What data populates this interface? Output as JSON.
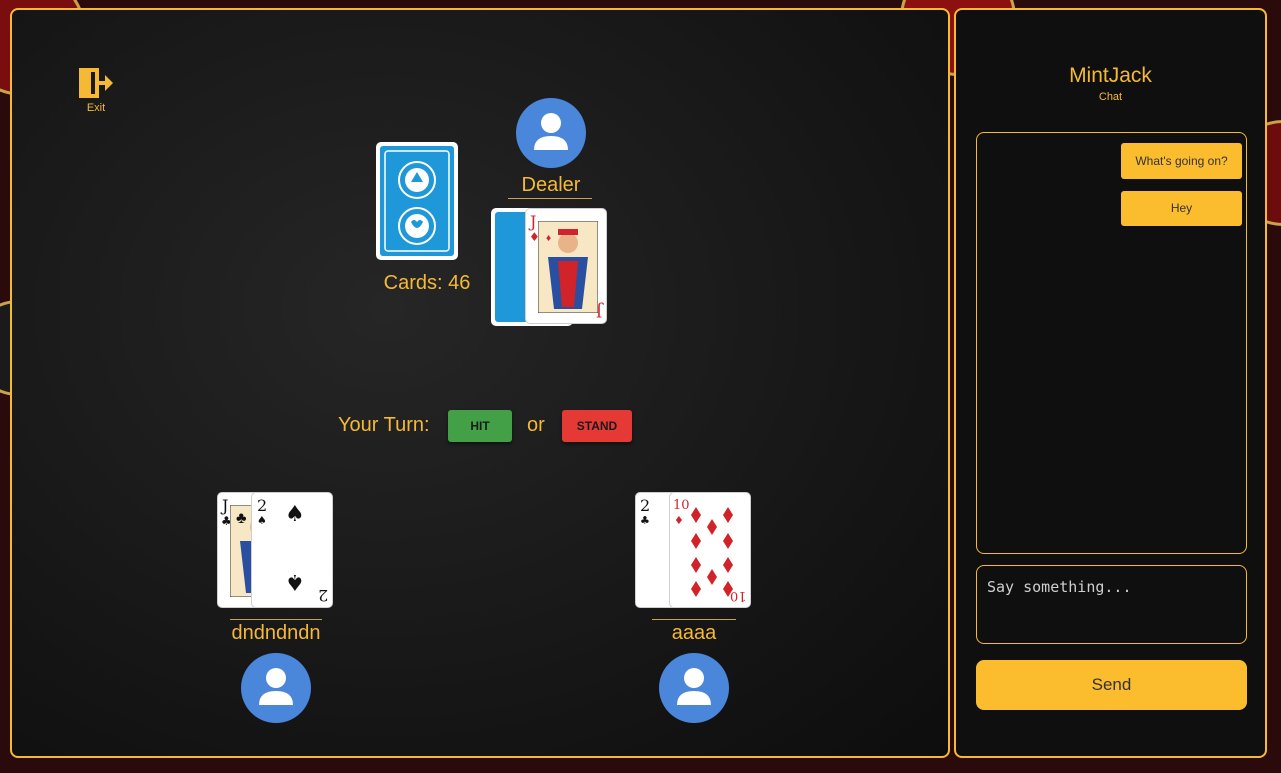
{
  "exit": {
    "label": "Exit",
    "icon": "exit-door-icon"
  },
  "dealer": {
    "name": "Dealer",
    "icon": "user-avatar-icon"
  },
  "deck": {
    "count_label": "Cards: 46"
  },
  "turn": {
    "label": "Your Turn:",
    "hit_label": "HIT",
    "or_label": "or",
    "stand_label": "STAND"
  },
  "players": [
    {
      "name": "dndndndn",
      "cards": [
        "J♣",
        "2♠"
      ]
    },
    {
      "name": "aaaa",
      "cards": [
        "2♣",
        "10♦"
      ]
    }
  ],
  "dealer_cards": [
    "face-down",
    "J♦"
  ],
  "chat": {
    "title": "MintJack",
    "subtitle": "Chat",
    "messages": [
      "What's going on?",
      "Hey"
    ],
    "input_placeholder": "Say something...",
    "send_label": "Send"
  },
  "colors": {
    "accent": "#f5b935",
    "hit": "#43a047",
    "stand": "#e53935",
    "avatar": "#4a86d9",
    "card_back": "#1e98d8"
  }
}
